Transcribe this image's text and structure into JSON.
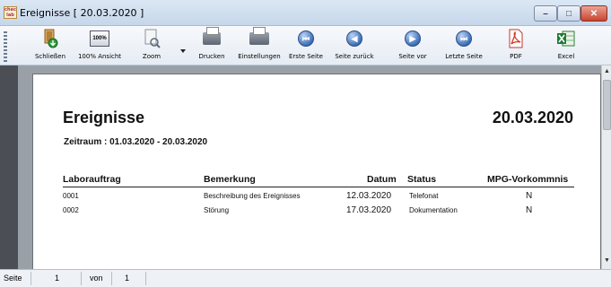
{
  "window": {
    "title": "Ereignisse [ 20.03.2020 ]",
    "app_icon_text": "chec\nlab",
    "buttons": {
      "minimize": "–",
      "maximize": "□",
      "close": "✕"
    }
  },
  "toolbar": {
    "items": [
      {
        "label": "Schließen",
        "icon": "close-door-icon"
      },
      {
        "label": "100% Ansicht",
        "icon": "zoom-100-icon",
        "icon_text": "100%"
      },
      {
        "label": "Zoom",
        "icon": "zoom-page-icon"
      },
      {
        "label": "Drucken",
        "icon": "printer-icon"
      },
      {
        "label": "Einstellungen",
        "icon": "printer-settings-icon"
      },
      {
        "label": "Erste Seite",
        "icon": "first-page-icon",
        "glyph": "⏮"
      },
      {
        "label": "Seite zurück",
        "icon": "previous-page-icon",
        "glyph": "◀"
      },
      {
        "label": "Seite vor",
        "icon": "next-page-icon",
        "glyph": "▶"
      },
      {
        "label": "Letzte Seite",
        "icon": "last-page-icon",
        "glyph": "⏭"
      },
      {
        "label": "PDF",
        "icon": "pdf-icon"
      },
      {
        "label": "Excel",
        "icon": "excel-icon"
      }
    ]
  },
  "report": {
    "title": "Ereignisse",
    "date": "20.03.2020",
    "range": "Zeitraum :   01.03.2020 - 20.03.2020",
    "columns": {
      "laborauftrag": "Laborauftrag",
      "bemerkung": "Bemerkung",
      "datum": "Datum",
      "status": "Status",
      "mpg": "MPG-Vorkommnis"
    },
    "rows": [
      {
        "laborauftrag": "0001",
        "bemerkung": "Beschreibung des Ereignisses",
        "datum": "12.03.2020",
        "status": "Telefonat",
        "mpg": "N"
      },
      {
        "laborauftrag": "0002",
        "bemerkung": "Störung",
        "datum": "17.03.2020",
        "status": "Dokumentation",
        "mpg": "N"
      }
    ]
  },
  "statusbar": {
    "page_label": "Seite",
    "page": "1",
    "of_label": "von",
    "total": "1"
  }
}
